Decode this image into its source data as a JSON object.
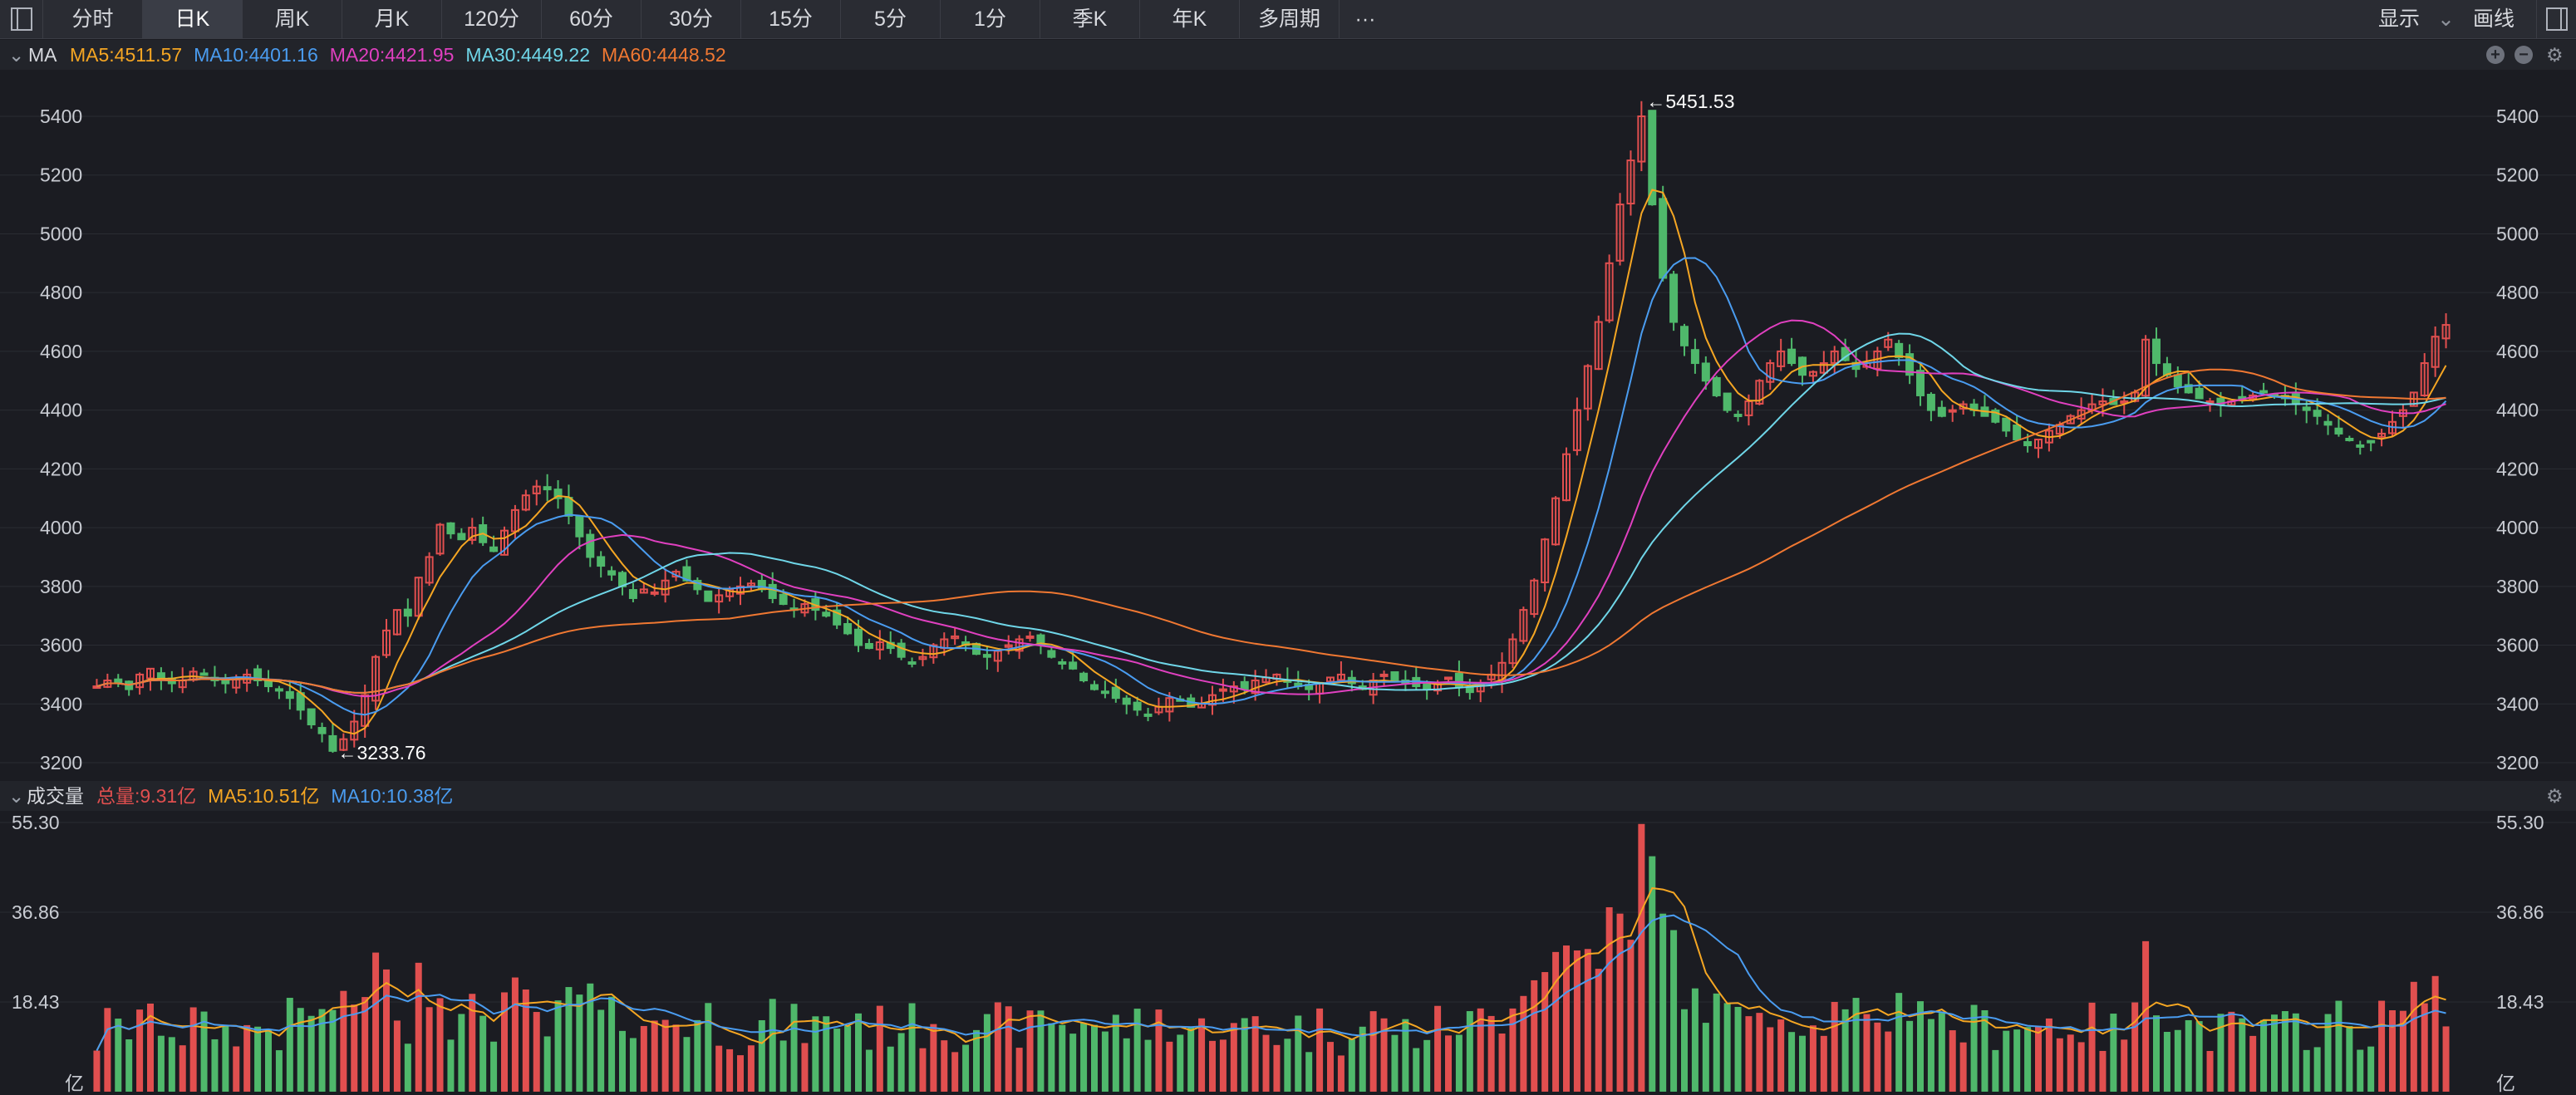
{
  "toolbar": {
    "tabs": [
      {
        "label": "分时",
        "active": false
      },
      {
        "label": "日K",
        "active": true
      },
      {
        "label": "周K",
        "active": false
      },
      {
        "label": "月K",
        "active": false
      },
      {
        "label": "120分",
        "active": false
      },
      {
        "label": "60分",
        "active": false
      },
      {
        "label": "30分",
        "active": false
      },
      {
        "label": "15分",
        "active": false
      },
      {
        "label": "5分",
        "active": false
      },
      {
        "label": "1分",
        "active": false
      },
      {
        "label": "季K",
        "active": false
      },
      {
        "label": "年K",
        "active": false
      },
      {
        "label": "多周期",
        "active": false
      }
    ],
    "more": "···",
    "display_label": "显示",
    "draw_label": "画线"
  },
  "price_panel": {
    "name": "MA",
    "indicators": [
      {
        "label": "MA5:4511.57",
        "color": "#f5a623"
      },
      {
        "label": "MA10:4401.16",
        "color": "#4a9cf0"
      },
      {
        "label": "MA20:4421.95",
        "color": "#e040c0"
      },
      {
        "label": "MA30:4449.22",
        "color": "#6fd6e8"
      },
      {
        "label": "MA60:4448.52",
        "color": "#f07832"
      }
    ],
    "high_label": "←5451.53",
    "low_label": "←3233.76",
    "y_ticks": [
      "5400",
      "5200",
      "5000",
      "4800",
      "4600",
      "4400",
      "4200",
      "4000",
      "3800",
      "3600",
      "3400",
      "3200"
    ]
  },
  "volume_panel": {
    "name": "成交量",
    "indicators": [
      {
        "label": "总量:9.31亿",
        "color": "#e14f4f"
      },
      {
        "label": "MA5:10.51亿",
        "color": "#f5a623"
      },
      {
        "label": "MA10:10.38亿",
        "color": "#4a9cf0"
      }
    ],
    "y_ticks": [
      "55.30",
      "36.86",
      "18.43"
    ],
    "unit": "亿"
  },
  "colors": {
    "up": "#e14f4f",
    "down": "#4fb86b",
    "grid": "#2a2c33"
  },
  "chart_data": [
    {
      "type": "candlestick",
      "ylim": [
        3200,
        5480
      ],
      "y_ticks": [
        5400,
        5200,
        5000,
        4800,
        4600,
        4400,
        4200,
        4000,
        3800,
        3600,
        3400,
        3200
      ],
      "series_close": [
        3460,
        3480,
        3470,
        3450,
        3500,
        3520,
        3490,
        3470,
        3480,
        3510,
        3500,
        3480,
        3470,
        3490,
        3500,
        3480,
        3460,
        3450,
        3420,
        3380,
        3330,
        3300,
        3240,
        3280,
        3340,
        3430,
        3560,
        3650,
        3720,
        3700,
        3830,
        3900,
        4010,
        3980,
        3960,
        4000,
        3950,
        3920,
        3990,
        4060,
        4110,
        4140,
        4130,
        4100,
        4040,
        3970,
        3900,
        3870,
        3840,
        3800,
        3760,
        3790,
        3780,
        3820,
        3850,
        3820,
        3790,
        3750,
        3770,
        3790,
        3800,
        3810,
        3790,
        3760,
        3740,
        3720,
        3740,
        3720,
        3700,
        3670,
        3640,
        3600,
        3590,
        3610,
        3590,
        3560,
        3540,
        3560,
        3600,
        3620,
        3630,
        3600,
        3570,
        3560,
        3580,
        3600,
        3620,
        3630,
        3600,
        3560,
        3540,
        3520,
        3480,
        3450,
        3440,
        3420,
        3400,
        3380,
        3360,
        3390,
        3420,
        3410,
        3390,
        3400,
        3430,
        3450,
        3460,
        3450,
        3480,
        3490,
        3500,
        3480,
        3460,
        3450,
        3470,
        3490,
        3500,
        3470,
        3450,
        3480,
        3500,
        3480,
        3470,
        3460,
        3450,
        3470,
        3490,
        3460,
        3440,
        3470,
        3500,
        3540,
        3620,
        3720,
        3820,
        3960,
        4100,
        4250,
        4400,
        4550,
        4700,
        4900,
        5100,
        5250,
        5400,
        5100,
        4850,
        4700,
        4620,
        4560,
        4500,
        4450,
        4400,
        4380,
        4430,
        4500,
        4560,
        4600,
        4560,
        4520,
        4530,
        4560,
        4600,
        4570,
        4540,
        4560,
        4600,
        4640,
        4580,
        4520,
        4450,
        4400,
        4380,
        4400,
        4420,
        4400,
        4380,
        4360,
        4330,
        4300,
        4280,
        4300,
        4330,
        4350,
        4380,
        4400,
        4420,
        4430,
        4420,
        4430,
        4460,
        4640,
        4560,
        4520,
        4480,
        4460,
        4440,
        4430,
        4420,
        4430,
        4440,
        4450,
        4460,
        4450,
        4440,
        4420,
        4400,
        4380,
        4350,
        4320,
        4300,
        4280,
        4290,
        4320,
        4360,
        4400,
        4460,
        4560,
        4650,
        4690
      ]
    },
    {
      "type": "bar",
      "ylim": [
        0,
        55.3
      ],
      "y_ticks": [
        55.3,
        36.86,
        18.43
      ],
      "volume_note": "volume bars (亿), colored by candle direction"
    }
  ]
}
